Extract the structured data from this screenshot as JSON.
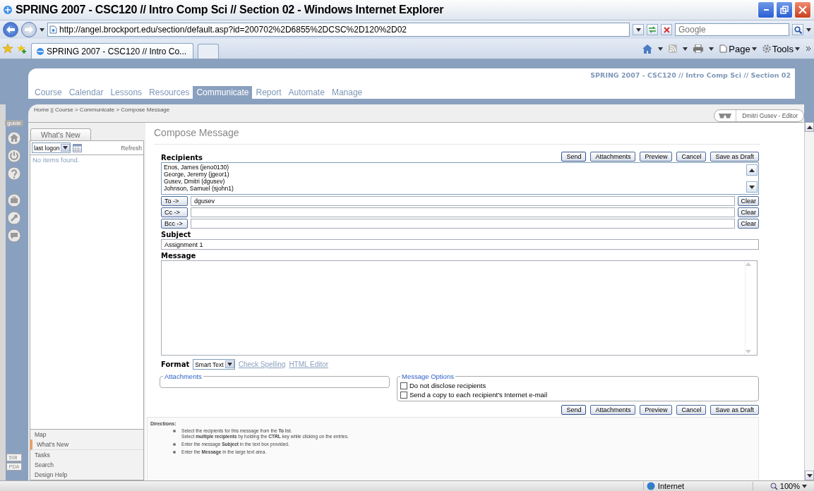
{
  "window": {
    "title": "SPRING 2007 - CSC120 // Intro Comp Sci // Section 02 - Windows Internet Explorer"
  },
  "address_bar": {
    "url": "http://angel.brockport.edu/section/default.asp?id=200702%2D6855%2DCSC%2D120%2D02",
    "search_placeholder": "Google"
  },
  "browser_tabs": [
    {
      "label": "SPRING 2007 - CSC120 // Intro Co...",
      "selected": true
    }
  ],
  "command_bar": [
    "Page",
    "Tools"
  ],
  "site": {
    "course_title": "SPRING 2007 - CSC120 // Intro Comp Sci // Section 02",
    "nav": [
      {
        "label": "Course",
        "selected": false
      },
      {
        "label": "Calendar",
        "selected": false
      },
      {
        "label": "Lessons",
        "selected": false
      },
      {
        "label": "Resources",
        "selected": false
      },
      {
        "label": "Communicate",
        "selected": true
      },
      {
        "label": "Report",
        "selected": false
      },
      {
        "label": "Automate",
        "selected": false
      },
      {
        "label": "Manage",
        "selected": false
      }
    ],
    "breadcrumb": "Home || Course > Communicate > Compose Message",
    "user": "Dmitri Gusev - Editor",
    "guide": "guide"
  },
  "sidebar": {
    "tab": "What's New",
    "filter": "last logon",
    "refresh": "Refresh",
    "empty": "No items found.",
    "menu": [
      {
        "label": "Map",
        "selected": false
      },
      {
        "label": "What's New",
        "selected": true
      },
      {
        "label": "Tasks",
        "selected": false
      },
      {
        "label": "Search",
        "selected": false
      },
      {
        "label": "Design Help",
        "selected": false
      }
    ],
    "badges": [
      "508",
      "PDA"
    ]
  },
  "compose": {
    "title": "Compose Message",
    "buttons": [
      "Send",
      "Attachments",
      "Preview",
      "Cancel",
      "Save as Draft"
    ],
    "recipients_label": "Recipients",
    "recipients": [
      "Enos, James (jeno0130)",
      "George, Jeremy (jgeor1)",
      "Gusev, Dmitri (dgusev)",
      "Johnson, Samuel (sjohn1)"
    ],
    "address_rows": [
      {
        "button": "To ->",
        "value": "dgusev",
        "clear": "Clear"
      },
      {
        "button": "Cc ->",
        "clear": "Clear"
      },
      {
        "button": "Bcc ->",
        "clear": "Clear"
      }
    ],
    "subject_label": "Subject",
    "subject": "Assignment 1",
    "message_label": "Message",
    "format_label": "Format",
    "format": "Smart Text",
    "links": [
      "Check Spelling",
      "HTML Editor"
    ],
    "attachments_legend": "Attachments",
    "options_legend": "Message Options",
    "options": [
      {
        "label": "Do not disclose recipients",
        "checked": false
      },
      {
        "label": "Send a copy to each recipient's Internet e-mail",
        "checked": false
      }
    ],
    "bottom_buttons": [
      "Send",
      "Attachments",
      "Preview",
      "Cancel",
      "Save as Draft"
    ],
    "directions": {
      "title": "Directions:",
      "items": [
        [
          "Select the recipients for this message from the **To** list.",
          "Select **multiple recipients** by holding the **CTRL** key while clicking on the entries."
        ],
        [
          "Enter the message **Subject** in the text box provided."
        ],
        [
          "Enter the **Message** in the large text area."
        ]
      ]
    }
  },
  "status_bar": {
    "zone": "Internet",
    "zoom": "100%"
  }
}
